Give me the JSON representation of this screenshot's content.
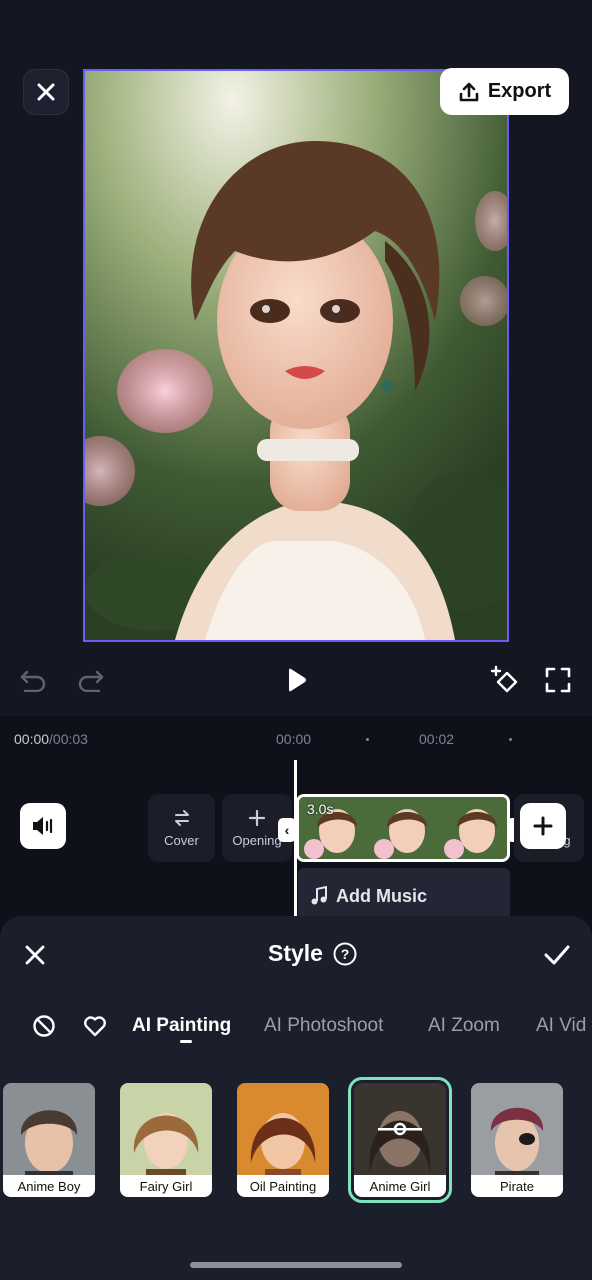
{
  "header": {
    "export_label": "Export"
  },
  "timeline": {
    "current_time": "00:00",
    "total_time": "/00:03",
    "ruler": [
      "00:00",
      "00:02"
    ],
    "cover_label": "Cover",
    "opening_label": "Opening",
    "ending_label_partial": "g",
    "clip_duration": "3.0s",
    "add_music_label": "Add Music"
  },
  "sheet": {
    "title": "Style",
    "tabs": [
      "AI Painting",
      "AI Photoshoot",
      "AI Zoom",
      "AI Vid"
    ],
    "active_tab": "AI Painting",
    "styles": [
      {
        "label": "Anime Boy"
      },
      {
        "label": "Fairy Girl"
      },
      {
        "label": "Oil Painting"
      },
      {
        "label": "Anime Girl",
        "selected": true
      },
      {
        "label": "Pirate"
      }
    ]
  },
  "colors": {
    "accent": "#6a5cf6",
    "selected_outline": "#7ee2bf",
    "background": "#141722"
  }
}
